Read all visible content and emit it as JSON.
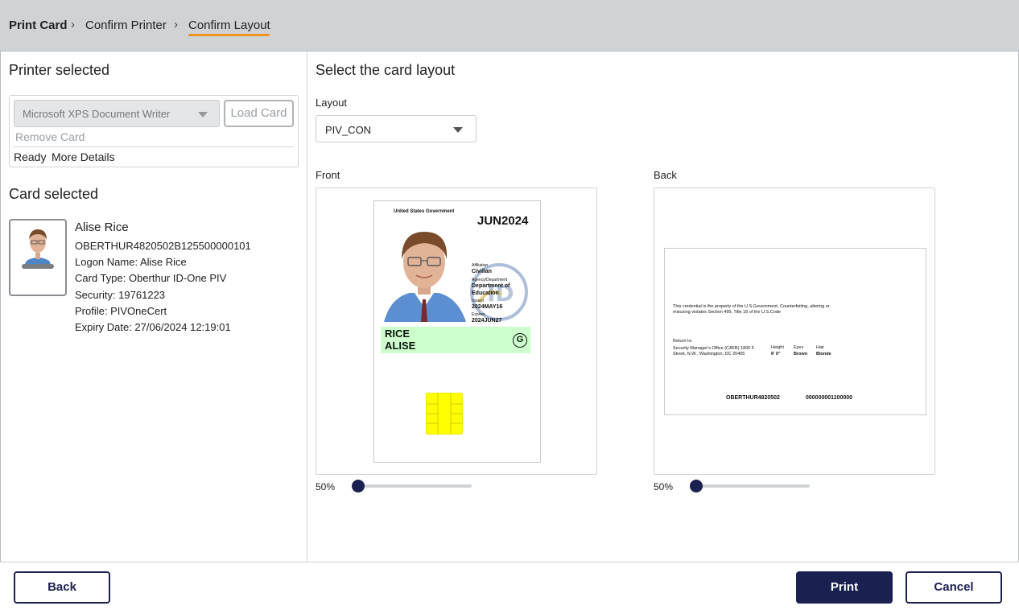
{
  "breadcrumb": {
    "items": [
      "Print Card",
      "Confirm Printer",
      "Confirm Layout"
    ],
    "separator": ">"
  },
  "printer_panel": {
    "title": "Printer selected",
    "printer_value": "Microsoft XPS Document Writer",
    "load_card_label": "Load Card",
    "remove_card_label": "Remove Card",
    "status_text": "Ready",
    "more_details_label": "More Details"
  },
  "card_panel": {
    "title": "Card selected",
    "name": "Alise Rice",
    "card_id": "OBERTHUR4820502B125500000101",
    "logon_name": "Logon Name: Alise Rice",
    "card_type": "Card Type: Oberthur ID-One PIV",
    "security": "Security: 19761223",
    "profile": "Profile: PIVOneCert",
    "expiry": "Expiry Date: 27/06/2024 12:19:01"
  },
  "layout_panel": {
    "title": "Select the card layout",
    "layout_label": "Layout",
    "layout_value": "PIV_CON",
    "front_label": "Front",
    "back_label": "Back",
    "front_zoom": "50%",
    "back_zoom": "50%",
    "front_zoom_level": 0.0,
    "back_zoom_level": 0.0
  },
  "card_front": {
    "issuer": "United States Government",
    "expiry_code": "JUN2024",
    "affiliation_label": "Affiliation",
    "affiliation_value": "Civilian",
    "agency_label": "Agency/Department",
    "agency_value_1": "Department of",
    "agency_value_2": "Education",
    "issued_label": "Issued",
    "issued_value": "2024MAY16",
    "expires_label": "Expires",
    "expires_value": "2024JUN27",
    "surname": "RICE",
    "given_name": "ALISE",
    "badge_letter": "G",
    "name_band_color": "#ccffcc",
    "chip_color": "#ffff00"
  },
  "card_back": {
    "notice_1": "This credential is the property of the U.S.Government. Counterfeiting, altering or",
    "notice_2": "misusing violates Section 499, Title 18 of the U.S.Code",
    "return_to": "Return to:",
    "address_1": "Security Manager's Office (CAFB) 1800 F",
    "address_2": "Street, N.W., Washington, DC 20405",
    "height_label": "Height",
    "height_value": "6' 0\"",
    "eyes_label": "Eyes",
    "eyes_value": "Brown",
    "hair_label": "Hair",
    "hair_value": "Blonde",
    "serial_1": "OBERTHUR4820502",
    "serial_2": "000000001100000"
  },
  "footer": {
    "back_label": "Back",
    "print_label": "Print",
    "cancel_label": "Cancel"
  },
  "colors": {
    "accent": "#f0921e",
    "primary": "#1a2151",
    "header_bg": "#cfd3d6"
  }
}
